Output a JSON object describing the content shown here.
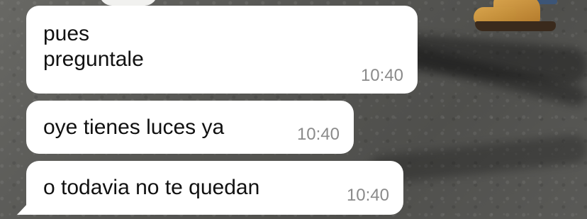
{
  "messages": [
    {
      "text": "pues\npreguntale",
      "time": "10:40"
    },
    {
      "text": "oye tienes luces ya",
      "time": "10:40"
    },
    {
      "text": "o todavia no te quedan",
      "time": "10:40"
    }
  ],
  "colors": {
    "bubble_background": "#ffffff",
    "message_text": "#111111",
    "timestamp_text": "#8a8a8a"
  }
}
